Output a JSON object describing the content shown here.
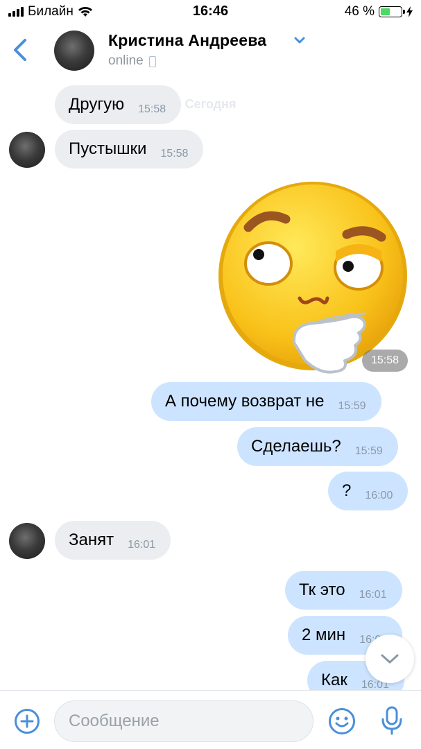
{
  "status_bar": {
    "carrier": "Билайн",
    "time": "16:46",
    "battery_text": "46 %",
    "battery_level": 0.46
  },
  "header": {
    "contact_name": "Кристина Андреева",
    "status": "online",
    "back_icon": "back-chevron-icon",
    "chevron_icon": "chevron-down-icon"
  },
  "chat": {
    "date_separator": "Сегодня",
    "messages": [
      {
        "dir": "in",
        "text": "Другую",
        "time": "15:58"
      },
      {
        "dir": "in",
        "text": "Пустышки",
        "time": "15:58"
      },
      {
        "dir": "out",
        "type": "sticker",
        "sticker": "thinking-face-sticker",
        "time": "15:58"
      },
      {
        "dir": "out",
        "text": "А почему возврат не",
        "time": "15:59"
      },
      {
        "dir": "out",
        "text": "Сделаешь?",
        "time": "15:59"
      },
      {
        "dir": "out",
        "text": "?",
        "time": "16:00"
      },
      {
        "dir": "in",
        "text": "Занят",
        "time": "16:01"
      },
      {
        "dir": "out",
        "text": "Тк это",
        "time": "16:01"
      },
      {
        "dir": "out",
        "text": "2 мин",
        "time": "16:01"
      },
      {
        "dir": "out",
        "text": "Как",
        "time": "16:01"
      }
    ]
  },
  "composer": {
    "placeholder": "Сообщение",
    "value": ""
  },
  "colors": {
    "accent": "#4a8fd9",
    "incoming_bubble": "#ebedf0",
    "outgoing_bubble": "#cce4ff",
    "timestamp": "#8a98a8"
  }
}
